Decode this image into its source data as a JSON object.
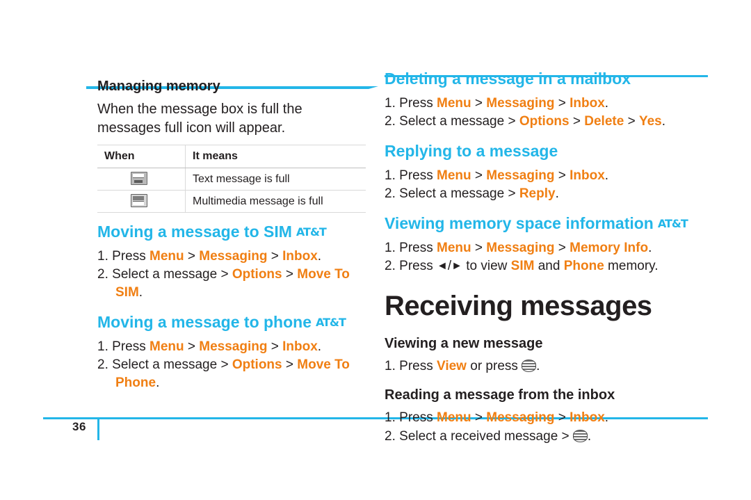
{
  "page": {
    "number": "36",
    "accent_color": "#23b6e8",
    "keyword_color": "#f07f13",
    "text_color": "#231f20"
  },
  "left_column": {
    "managing_memory": {
      "heading": "Managing memory",
      "paragraph": "When the message box is full the messages full icon will appear.",
      "table": {
        "headers": [
          "When",
          "It means"
        ],
        "rows": [
          {
            "icon": "sms-full-icon",
            "meaning": "Text message is full"
          },
          {
            "icon": "mms-full-icon",
            "meaning": "Multimedia message is full"
          }
        ]
      }
    },
    "move_to_sim": {
      "heading": "Moving a message to SIM",
      "badge": "att-logo",
      "steps": [
        {
          "num": "1.",
          "prefix": "Press ",
          "tokens": [
            "Menu",
            "Messaging",
            "Inbox"
          ],
          "suffix": "."
        },
        {
          "num": "2.",
          "prefix": "Select a message > ",
          "tokens": [
            "Options",
            "Move To SIM"
          ],
          "suffix": "."
        }
      ]
    },
    "move_to_phone": {
      "heading": "Moving a message to phone",
      "badge": "att-logo",
      "steps": [
        {
          "num": "1.",
          "prefix": "Press ",
          "tokens": [
            "Menu",
            "Messaging",
            "Inbox"
          ],
          "suffix": "."
        },
        {
          "num": "2.",
          "prefix": "Select a message > ",
          "tokens": [
            "Options",
            "Move To Phone"
          ],
          "suffix": "."
        }
      ]
    }
  },
  "right_column": {
    "deleting": {
      "heading": "Deleting a message in a mailbox",
      "steps": [
        {
          "num": "1.",
          "prefix": "Press ",
          "tokens": [
            "Menu",
            "Messaging",
            "Inbox"
          ],
          "suffix": "."
        },
        {
          "num": "2.",
          "prefix": "Select a message > ",
          "tokens": [
            "Options",
            "Delete",
            "Yes"
          ],
          "suffix": "."
        }
      ]
    },
    "replying": {
      "heading": "Replying to a message",
      "steps": [
        {
          "num": "1.",
          "prefix": "Press ",
          "tokens": [
            "Menu",
            "Messaging",
            "Inbox"
          ],
          "suffix": "."
        },
        {
          "num": "2.",
          "prefix": "Select a message > ",
          "tokens": [
            "Reply"
          ],
          "suffix": "."
        }
      ]
    },
    "memory_info": {
      "heading": "Viewing memory space information",
      "badge": "att-logo",
      "steps": [
        {
          "num": "1.",
          "prefix": "Press ",
          "tokens": [
            "Menu",
            "Messaging",
            "Memory Info"
          ],
          "suffix": "."
        },
        {
          "num": "2.",
          "text_parts": [
            "2. Press ",
            "◄",
            "/",
            "►",
            " to view ",
            "SIM",
            " and ",
            "Phone",
            " memory."
          ]
        }
      ]
    },
    "receiving_title": "Receiving messages",
    "viewing_new": {
      "heading": "Viewing a new message",
      "step_num": "1.",
      "step_prefix": "Press ",
      "step_keyword": "View",
      "step_mid": " or press ",
      "step_icon": "att-key-icon",
      "step_suffix": "."
    },
    "reading_inbox": {
      "heading": "Reading a message from the inbox",
      "steps": [
        {
          "num": "1.",
          "prefix": "Press ",
          "tokens": [
            "Menu",
            "Messaging",
            "Inbox"
          ],
          "suffix": "."
        }
      ],
      "step2_num": "2.",
      "step2_prefix": "Select a received message > ",
      "step2_icon": "att-key-icon",
      "step2_suffix": "."
    }
  }
}
